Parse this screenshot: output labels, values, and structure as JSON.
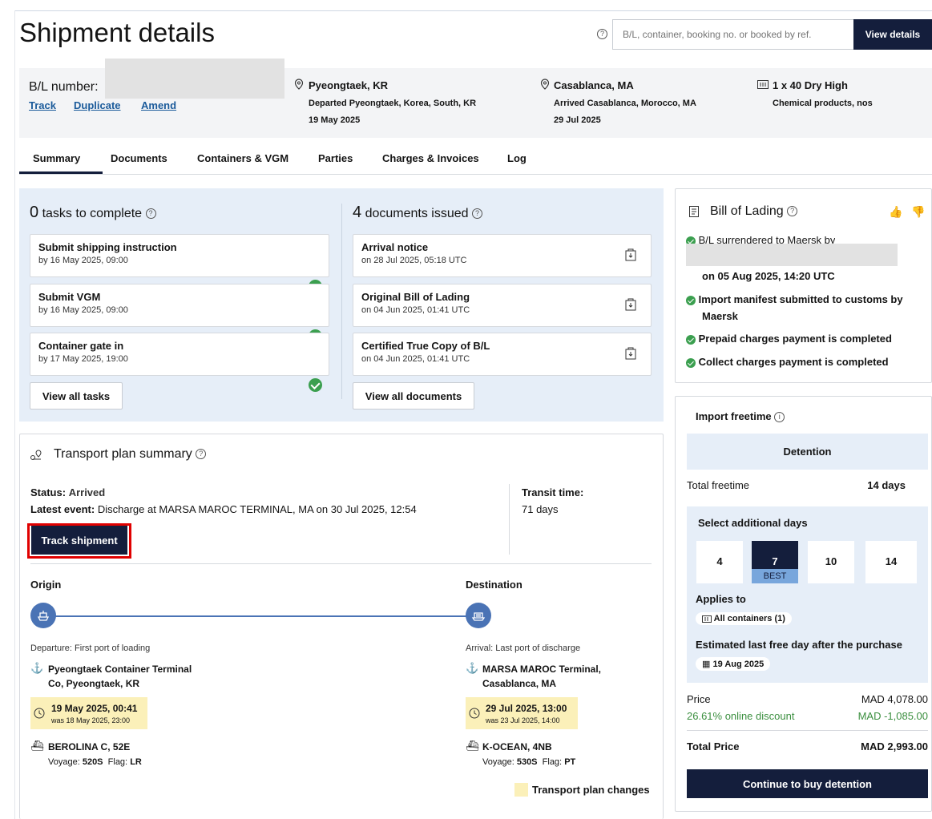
{
  "header": {
    "title": "Shipment details",
    "search_placeholder": "B/L, container, booking no. or booked by ref.",
    "view_details": "View details"
  },
  "bl_bar": {
    "bl_label": "B/L number:",
    "links": [
      "Track",
      "Duplicate",
      "Amend"
    ],
    "origin": {
      "name": "Pyeongtaek, KR",
      "line1": "Departed Pyeongtaek, Korea, South, KR",
      "line2": "19 May 2025"
    },
    "destination": {
      "name": "Casablanca, MA",
      "line1": "Arrived Casablanca, Morocco, MA",
      "line2": "29 Jul 2025"
    },
    "cargo": {
      "name": "1 x 40 Dry High",
      "line1": "Chemical products, nos"
    }
  },
  "tabs": [
    "Summary",
    "Documents",
    "Containers & VGM",
    "Parties",
    "Charges & Invoices",
    "Log"
  ],
  "tasks": {
    "count": "0",
    "heading": "tasks to complete",
    "items": [
      {
        "title": "Submit shipping instruction",
        "sub": "by 16 May 2025, 09:00"
      },
      {
        "title": "Submit VGM",
        "sub": "by 16 May 2025, 09:00"
      },
      {
        "title": "Container gate in",
        "sub": "by 17 May 2025, 19:00"
      }
    ],
    "view_all": "View all tasks"
  },
  "documents": {
    "count": "4",
    "heading": "documents issued",
    "items": [
      {
        "title": "Arrival notice",
        "sub": "on 28 Jul 2025, 05:18 UTC"
      },
      {
        "title": "Original Bill of Lading",
        "sub": "on 04 Jun 2025, 01:41 UTC"
      },
      {
        "title": "Certified True Copy of B/L",
        "sub": "on 04 Jun 2025, 01:41 UTC"
      }
    ],
    "view_all": "View all documents"
  },
  "bol": {
    "title": "Bill of Lading",
    "partial": "B/L surrendered to Maersk by",
    "date": "on 05 Aug 2025, 14:20 UTC",
    "items": [
      "Import manifest submitted to customs by",
      "Prepaid charges payment is completed",
      "Collect charges payment is completed"
    ],
    "item1_cont": "Maersk"
  },
  "transport": {
    "title": "Transport plan summary",
    "status_label": "Status:",
    "status_value": "Arrived",
    "latest_label": "Latest event:",
    "latest_value": "Discharge at MARSA MAROC TERMINAL, MA on 30 Jul 2025, 12:54",
    "track_button": "Track shipment",
    "transit_label": "Transit time:",
    "transit_value": "71 days",
    "origin": {
      "heading": "Origin",
      "label": "Departure: First port of loading",
      "terminal1": "Pyeongtaek Container Terminal",
      "terminal2": "Co, Pyeongtaek, KR",
      "date": "19 May 2025, 00:41",
      "was": "was 18 May 2025, 23:00",
      "vessel": "BEROLINA C, 52E",
      "voyage_label": "Voyage:",
      "voyage": "520S",
      "flag_label": "Flag:",
      "flag": "LR"
    },
    "destination": {
      "heading": "Destination",
      "label": "Arrival: Last port of discharge",
      "terminal1": "MARSA MAROC Terminal,",
      "terminal2": "Casablanca, MA",
      "date": "29 Jul 2025, 13:00",
      "was": "was 23 Jul 2025, 14:00",
      "vessel": "K-OCEAN, 4NB",
      "voyage_label": "Voyage:",
      "voyage": "530S",
      "flag_label": "Flag:",
      "flag": "PT"
    },
    "legend": "Transport plan changes"
  },
  "freetime": {
    "title": "Import freetime",
    "tab": "Detention",
    "total_label": "Total freetime",
    "total_value": "14 days",
    "select_label": "Select additional days",
    "days": [
      "4",
      "7",
      "10",
      "14"
    ],
    "best": "BEST",
    "applies_label": "Applies to",
    "applies_value": "All containers (1)",
    "est_label": "Estimated last free day after the purchase",
    "est_value": "19 Aug 2025",
    "price_label": "Price",
    "price_value": "MAD 4,078.00",
    "discount_label": "26.61% online discount",
    "discount_value": "MAD -1,085.00",
    "total_price_label": "Total Price",
    "total_price_value": "MAD 2,993.00",
    "continue": "Continue to buy detention"
  },
  "colors": {
    "dark": "#141e3c",
    "accent_blue": "#4a73b5",
    "green": "#3b9f4f",
    "highlight": "#fbf0b9",
    "panel_bg": "#e6eef8",
    "red_box": "#e00000"
  }
}
